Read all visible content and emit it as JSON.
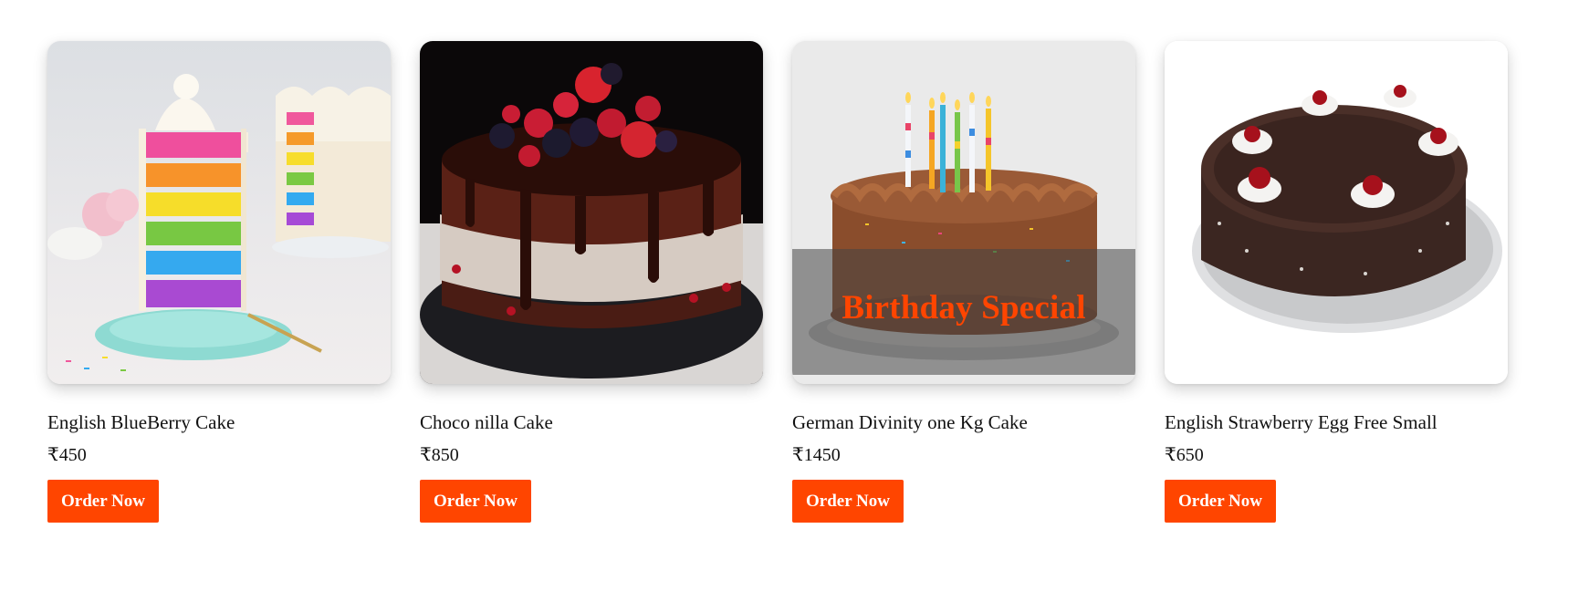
{
  "products": [
    {
      "name": "English BlueBerry Cake",
      "price": "₹450",
      "button_label": "Order Now",
      "image_icon": "rainbow-cake-slice-image"
    },
    {
      "name": "Choco nilla Cake",
      "price": "₹850",
      "button_label": "Order Now",
      "image_icon": "chocolate-berry-cake-image"
    },
    {
      "name": "German Divinity one Kg Cake",
      "price": "₹1450",
      "button_label": "Order Now",
      "image_icon": "birthday-candle-cake-image",
      "overlay_text": "Birthday Special"
    },
    {
      "name": "English Strawberry Egg Free Small",
      "price": "₹650",
      "button_label": "Order Now",
      "image_icon": "black-forest-cake-image"
    }
  ],
  "colors": {
    "accent": "#ff4500",
    "button_text": "#ffffff",
    "text": "#111111"
  }
}
